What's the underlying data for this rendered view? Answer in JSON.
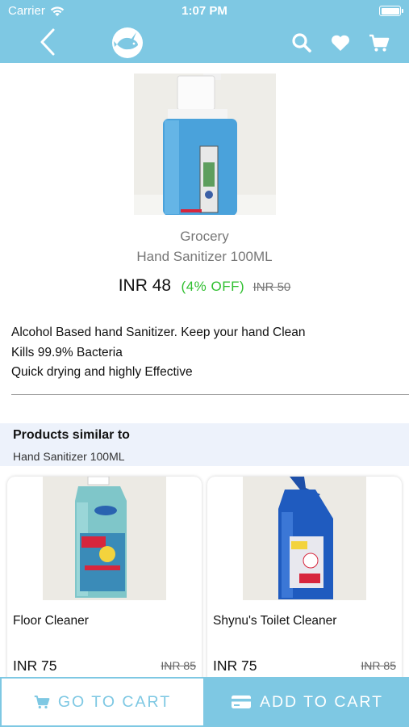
{
  "status_bar": {
    "carrier": "Carrier",
    "time": "1:07 PM"
  },
  "nav": {
    "icons": [
      "back-chevron-icon",
      "fish-logo-icon",
      "search-icon",
      "heart-icon",
      "cart-icon"
    ]
  },
  "product": {
    "image_icon": "hand-sanitizer-bottle",
    "category": "Grocery",
    "name": "Hand Sanitizer 100ML",
    "price": "INR 48",
    "discount": "(4% OFF)",
    "original_price": "INR 50",
    "description": [
      "Alcohol Based hand Sanitizer. Keep your hand Clean",
      "Kills 99.9% Bacteria",
      "Quick drying and highly Effective"
    ]
  },
  "similar": {
    "title": "Products similar to",
    "subtitle": "Hand Sanitizer 100ML",
    "items": [
      {
        "name": "Floor Cleaner",
        "price": "INR 75",
        "original_price": "INR 85",
        "image_icon": "floor-cleaner-bottle"
      },
      {
        "name": "Shynu's Toilet Cleaner",
        "price": "INR 75",
        "original_price": "INR 85",
        "image_icon": "toilet-cleaner-bottle"
      }
    ]
  },
  "actions": {
    "go_to_cart": "GO TO CART",
    "add_to_cart": "ADD TO CART"
  },
  "colors": {
    "accent": "#7ec8e3",
    "discount": "#2fbf2f",
    "similar_bg": "#edf2fb"
  }
}
